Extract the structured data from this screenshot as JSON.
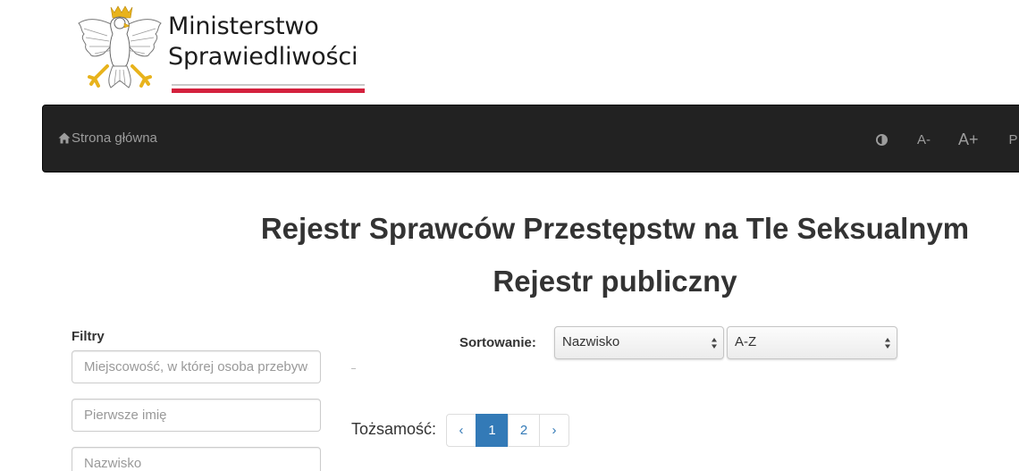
{
  "logo": {
    "line1": "Ministerstwo",
    "line2": "Sprawiedliwości"
  },
  "navbar": {
    "home_label": "Strona główna",
    "font_decrease_label": "A-",
    "font_increase_label": "A+",
    "cut_label": "P"
  },
  "titles": {
    "main": "Rejestr Sprawców Przestępstw na Tle Seksualnym",
    "sub": "Rejestr publiczny"
  },
  "filters": {
    "label": "Filtry",
    "inputs": [
      {
        "placeholder": "Miejscowość, w której osoba przebywa"
      },
      {
        "placeholder": "Pierwsze imię"
      },
      {
        "placeholder": "Nazwisko"
      }
    ]
  },
  "sorting": {
    "label": "Sortowanie:",
    "field_value": "Nazwisko",
    "order_value": "A-Z"
  },
  "pagination": {
    "label": "Tożsamość:",
    "prev": "‹",
    "pages": [
      "1",
      "2"
    ],
    "next": "›",
    "current": "1"
  },
  "colors": {
    "navbar_bg": "#222222",
    "navbar_text": "#9d9d9d",
    "accent": "#337ab7",
    "flag_red": "#d4213d"
  }
}
